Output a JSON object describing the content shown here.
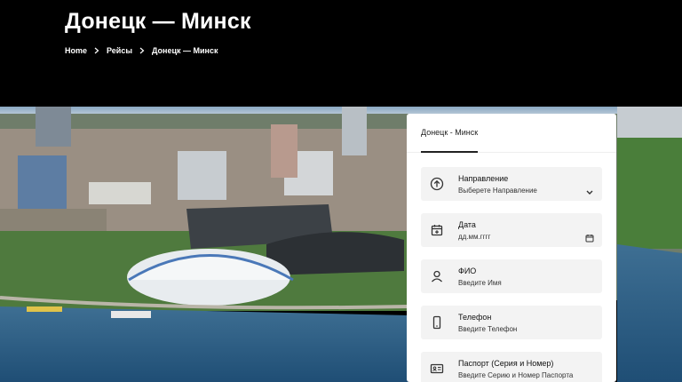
{
  "header": {
    "title": "Донецк — Минск",
    "breadcrumb": [
      "Home",
      "Рейсы",
      "Донецк — Минск"
    ]
  },
  "form": {
    "tab_label": "Донецк - Минск",
    "fields": [
      {
        "label": "Направление",
        "value": "Выберете Направление",
        "icon": "circle-arrow-up-icon"
      },
      {
        "label": "Дата",
        "value": "дд.мм.гггг",
        "icon": "calendar-plus-icon"
      },
      {
        "label": "ФИО",
        "value": "Введите Имя",
        "icon": "user-icon"
      },
      {
        "label": "Телефон",
        "value": "Введите Телефон",
        "icon": "phone-icon"
      },
      {
        "label": "Паспорт (Серия и Номер)",
        "value": "Введите Серию и Номер Паспорта",
        "icon": "id-card-icon"
      }
    ]
  },
  "colors": {
    "accent": "#222222",
    "field_bg": "#f3f3f3",
    "header_bg": "#000000"
  }
}
